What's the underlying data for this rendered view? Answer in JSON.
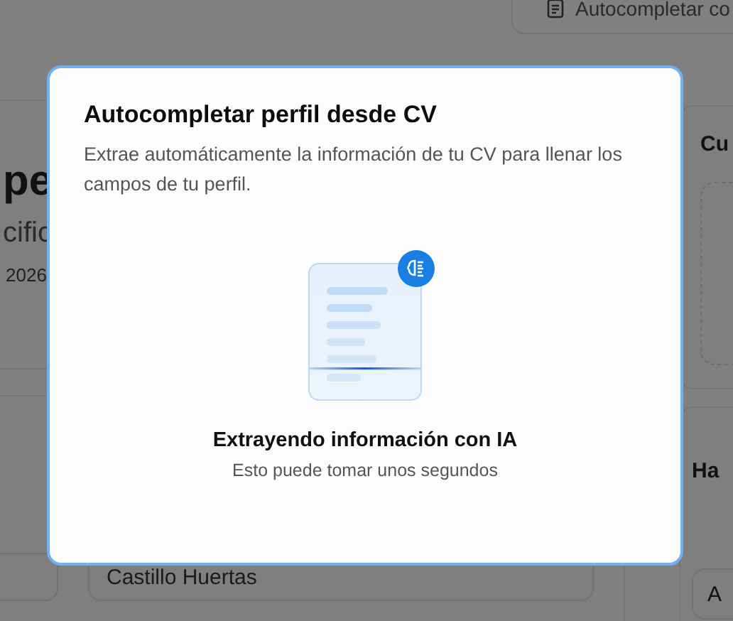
{
  "background": {
    "autofill_button": {
      "label": "Autocompletar co"
    },
    "profile_card": {
      "heading": "pe",
      "subtitle": "cific",
      "date": "2026"
    },
    "cv_card": {
      "title": "Cu"
    },
    "last_name_field": {
      "value": "Castillo Huertas"
    },
    "skills_card": {
      "title": "Ha",
      "field_value": "A"
    }
  },
  "modal": {
    "title": "Autocompletar perfil desde CV",
    "description": "Extrae automáticamente la información de tu CV para llenar los campos de tu perfil.",
    "status_title": "Extrayendo información con IA",
    "status_subtitle": "Esto puede tomar unos segundos"
  }
}
